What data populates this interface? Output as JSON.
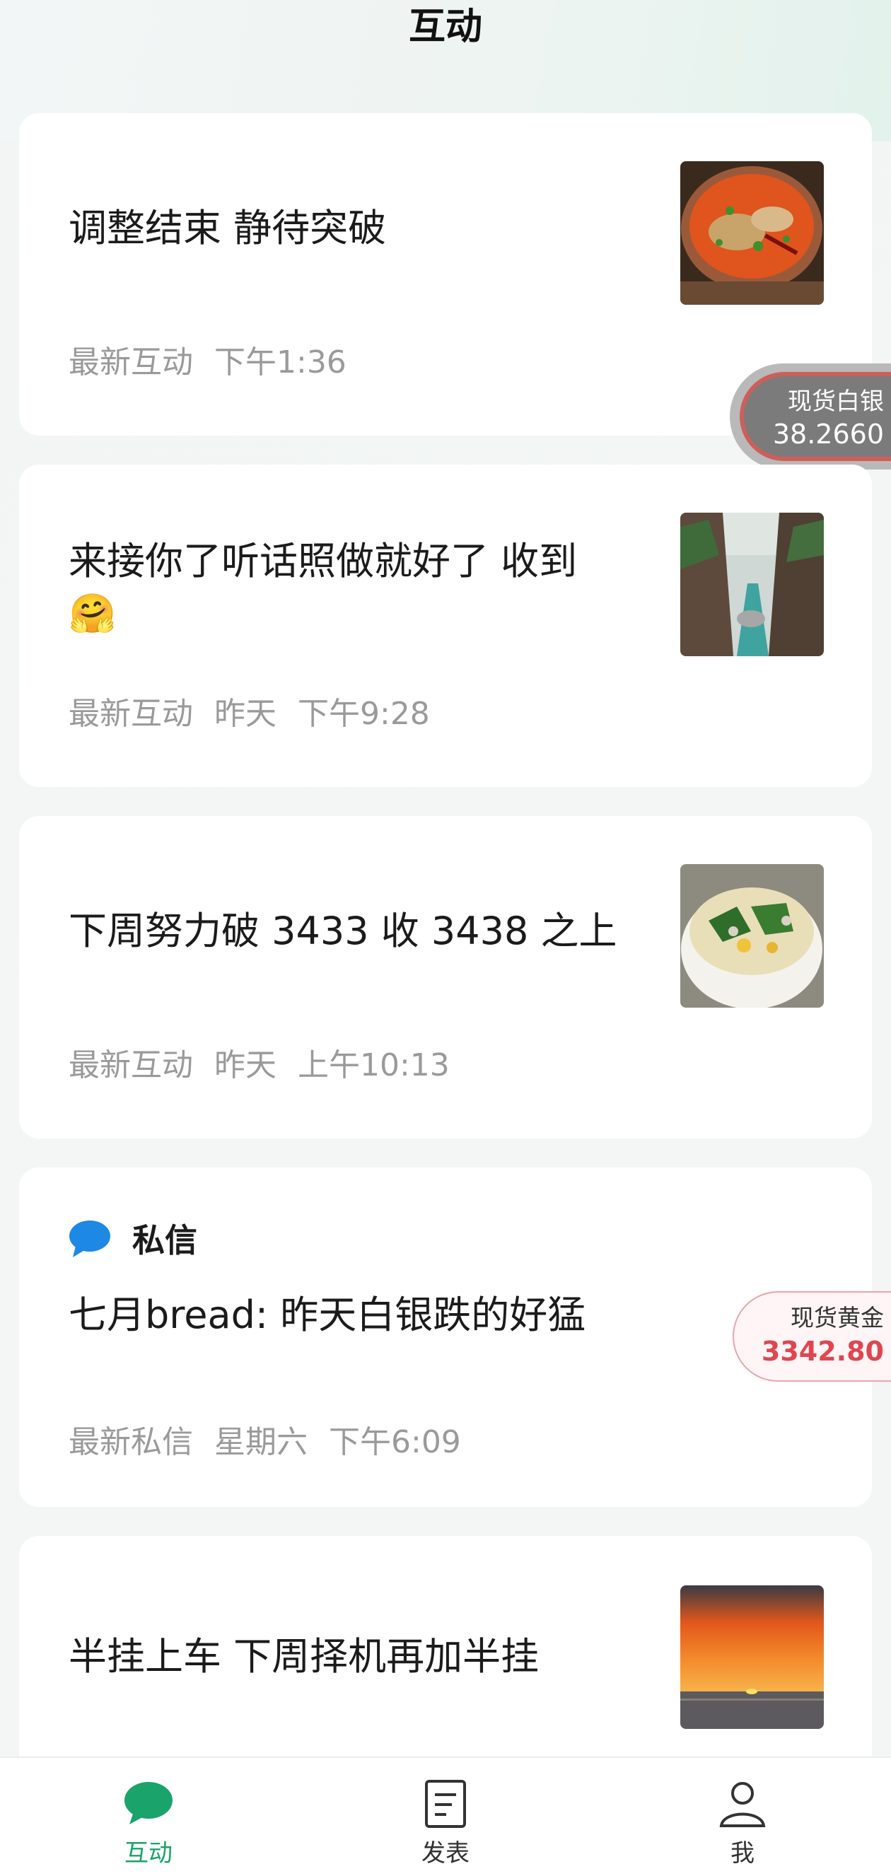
{
  "header": {
    "title": "互动"
  },
  "cards": [
    {
      "title": "调整结束 静待突破",
      "meta_label": "最新互动",
      "meta_day": "",
      "meta_time": "下午1:36",
      "thumb": "spicy-soup-photo"
    },
    {
      "title_line1": "来接你了听话照做就好了 收到",
      "title_line2": "🤗",
      "meta_label": "最新互动",
      "meta_day": "昨天",
      "meta_time": "下午9:28",
      "thumb": "canyon-river-photo"
    },
    {
      "title": "下周努力破 3433 收 3438 之上",
      "meta_label": "最新互动",
      "meta_day": "昨天",
      "meta_time": "上午10:13",
      "thumb": "vegetable-soup-photo"
    },
    {
      "header_label": "私信",
      "title": "七月bread: 昨天白银跌的好猛",
      "meta_label": "最新私信",
      "meta_day": "星期六",
      "meta_time": "下午6:09"
    },
    {
      "title": "半挂上车 下周择机再加半挂",
      "thumb": "sunset-sea-photo"
    }
  ],
  "badges": {
    "silver": {
      "name": "现货白银",
      "price": "38.2660"
    },
    "gold": {
      "name": "现货黄金",
      "price": "3342.80"
    }
  },
  "tabbar": {
    "items": [
      {
        "label": "互动",
        "icon": "chat-bubble-icon",
        "active": true
      },
      {
        "label": "发表",
        "icon": "document-icon",
        "active": false
      },
      {
        "label": "我",
        "icon": "person-icon",
        "active": false
      }
    ]
  },
  "colors": {
    "accent": "#1aa36a",
    "dm_icon": "#1e88e5",
    "gold_price": "#e0464f"
  }
}
